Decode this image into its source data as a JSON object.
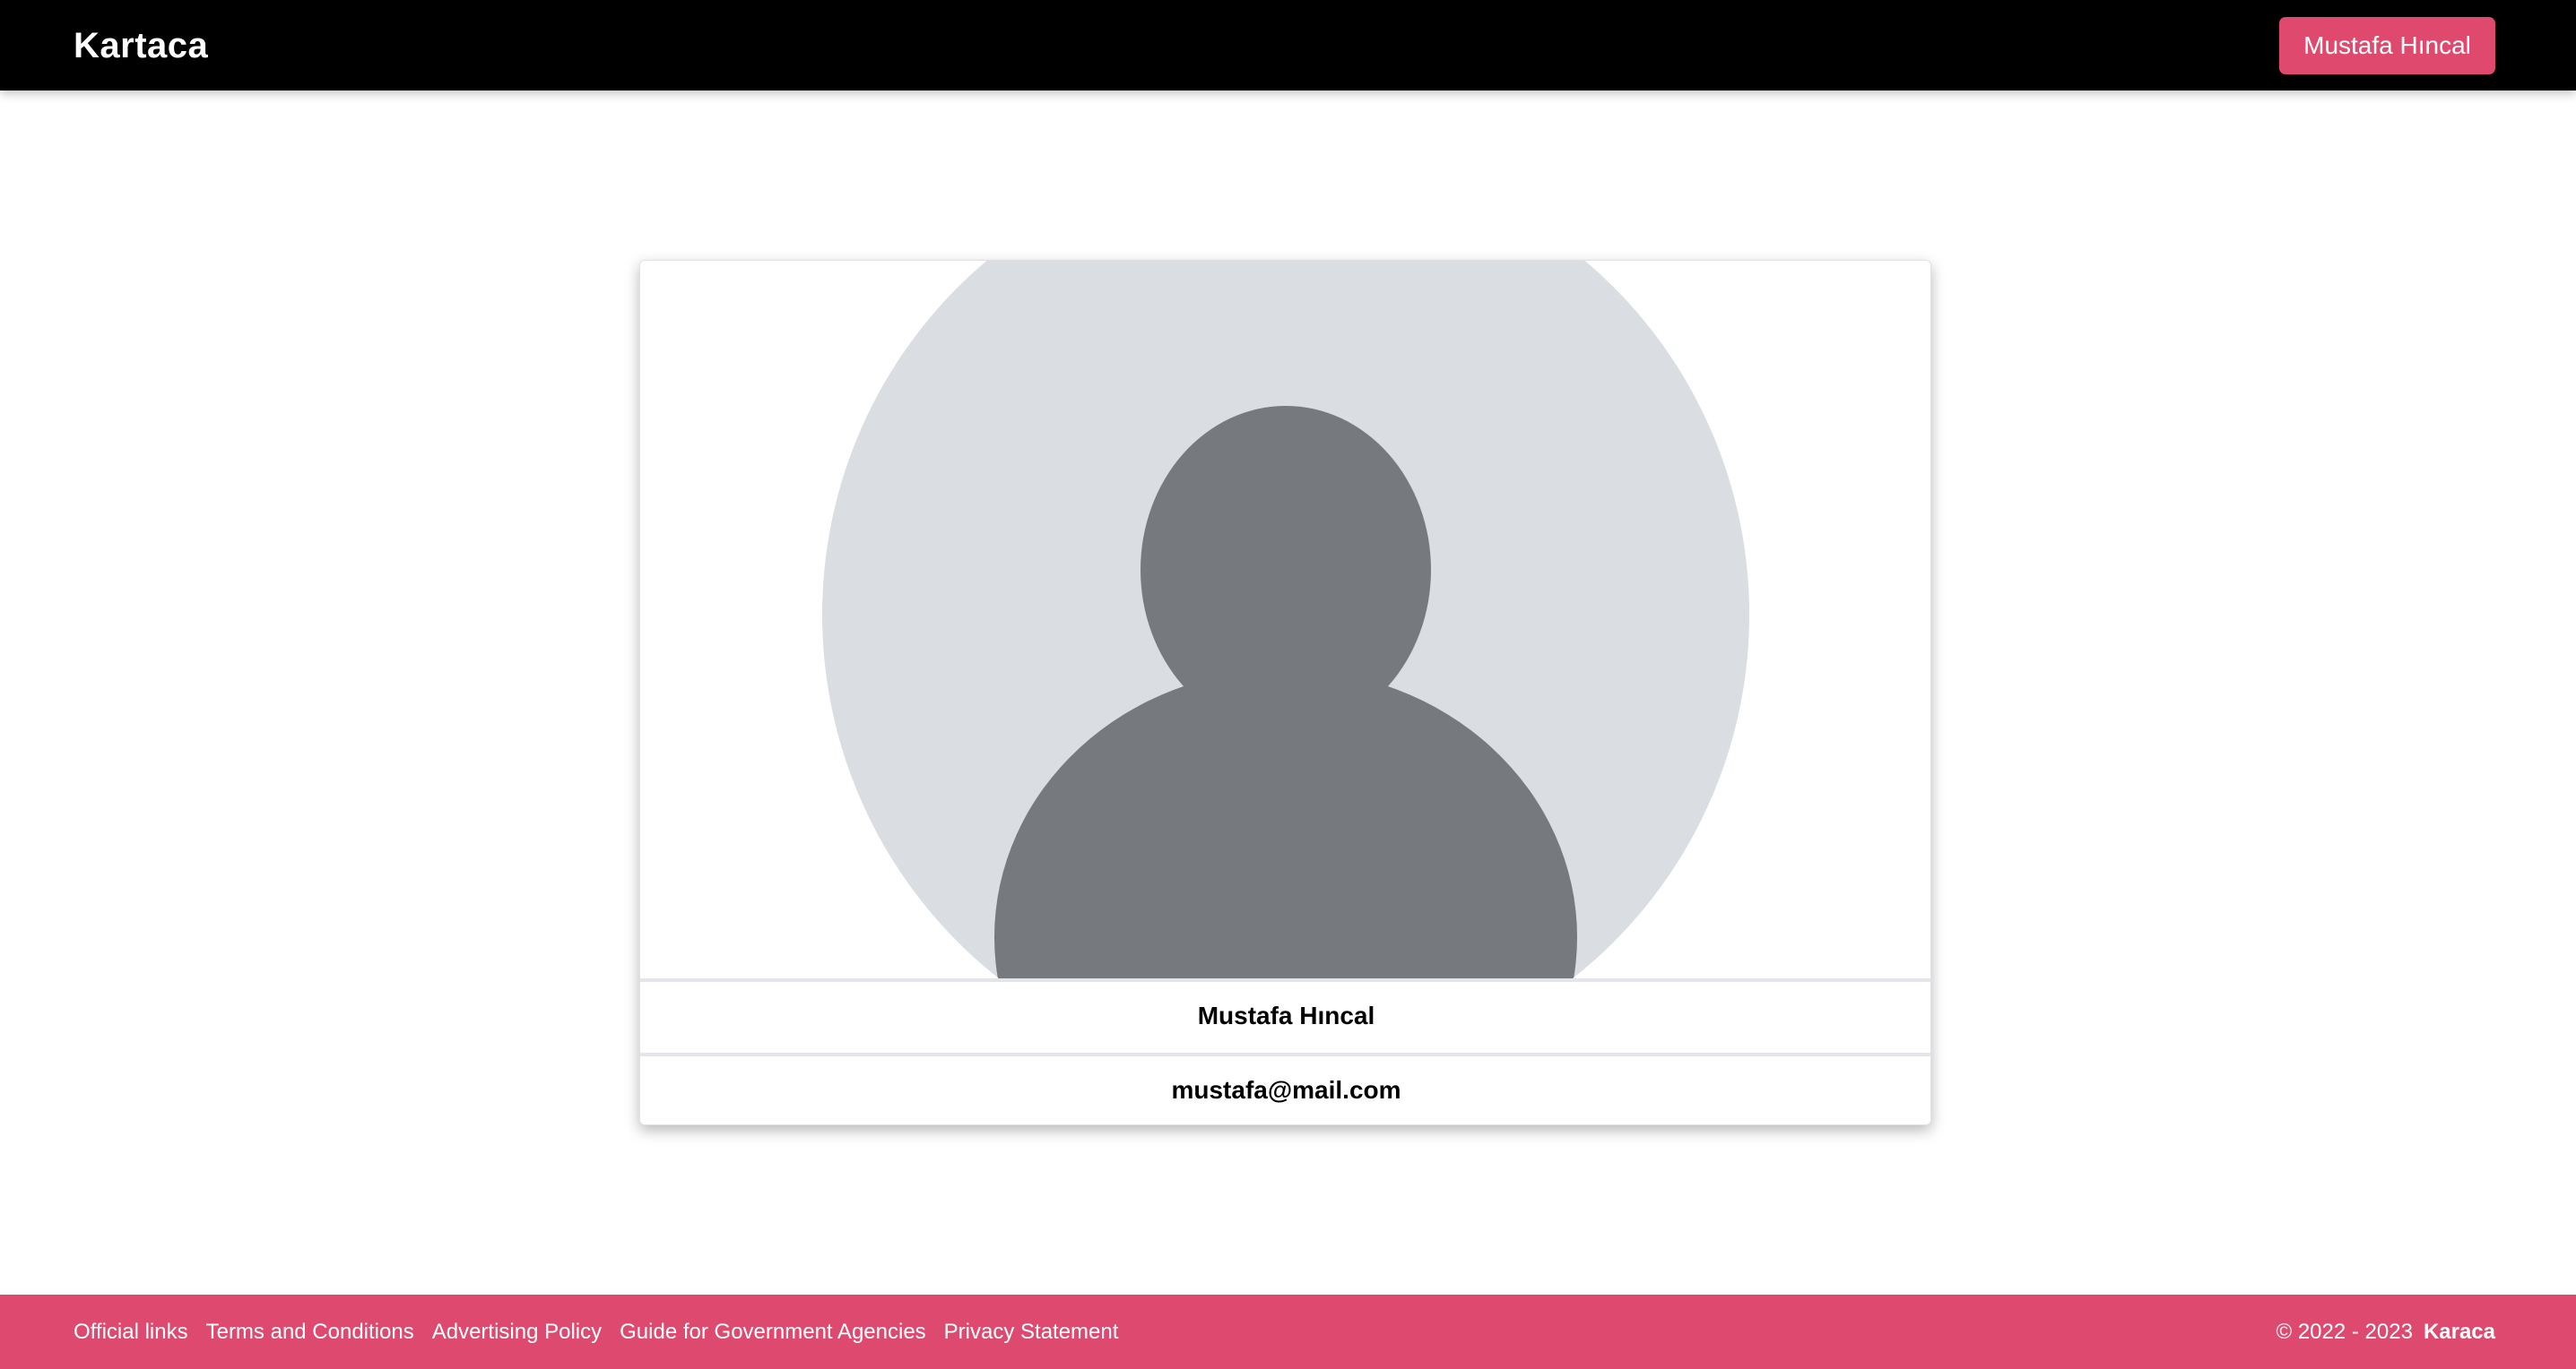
{
  "header": {
    "brand": "Kartaca",
    "user_button_label": "Mustafa Hıncal"
  },
  "profile": {
    "avatar_icon": "default-user-avatar-icon",
    "name": "Mustafa Hıncal",
    "email": "mustafa@mail.com"
  },
  "footer": {
    "links": [
      {
        "label": "Official links"
      },
      {
        "label": "Terms and Conditions"
      },
      {
        "label": "Advertising Policy"
      },
      {
        "label": "Guide for Government Agencies"
      },
      {
        "label": "Privacy Statement"
      }
    ],
    "copyright": "© 2022 - 2023",
    "brand": "Karaca"
  },
  "colors": {
    "header_bg": "#000000",
    "accent": "#de4a6f",
    "avatar_bg": "#dadde1",
    "avatar_figure": "#767a7f"
  }
}
